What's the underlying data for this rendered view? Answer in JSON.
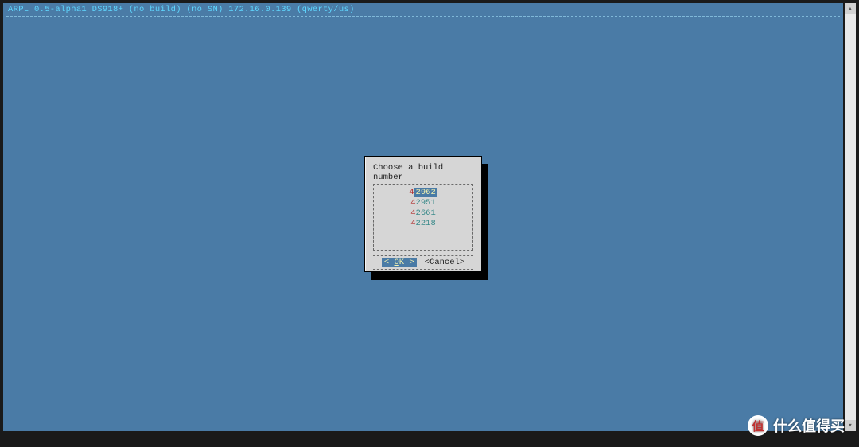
{
  "header": {
    "status_line": "ARPL 0.5-alpha1 DS918+ (no build) (no SN) 172.16.0.139 (qwerty/us)"
  },
  "dialog": {
    "title": "Choose a build number",
    "items": [
      {
        "prefix": "4",
        "build": "2962",
        "selected": true
      },
      {
        "prefix": "4",
        "build": "2951",
        "selected": false
      },
      {
        "prefix": "4",
        "build": "2661",
        "selected": false
      },
      {
        "prefix": "4",
        "build": "2218",
        "selected": false
      }
    ],
    "ok_left": "<",
    "ok_label_pre": " ",
    "ok_label_u": "O",
    "ok_label_post": "K ",
    "ok_right": ">",
    "cancel_label": "<Cancel>"
  },
  "watermark": {
    "badge": "值",
    "text": "什么值得买"
  },
  "scrollbar": {
    "up": "▴",
    "down": "▾"
  }
}
